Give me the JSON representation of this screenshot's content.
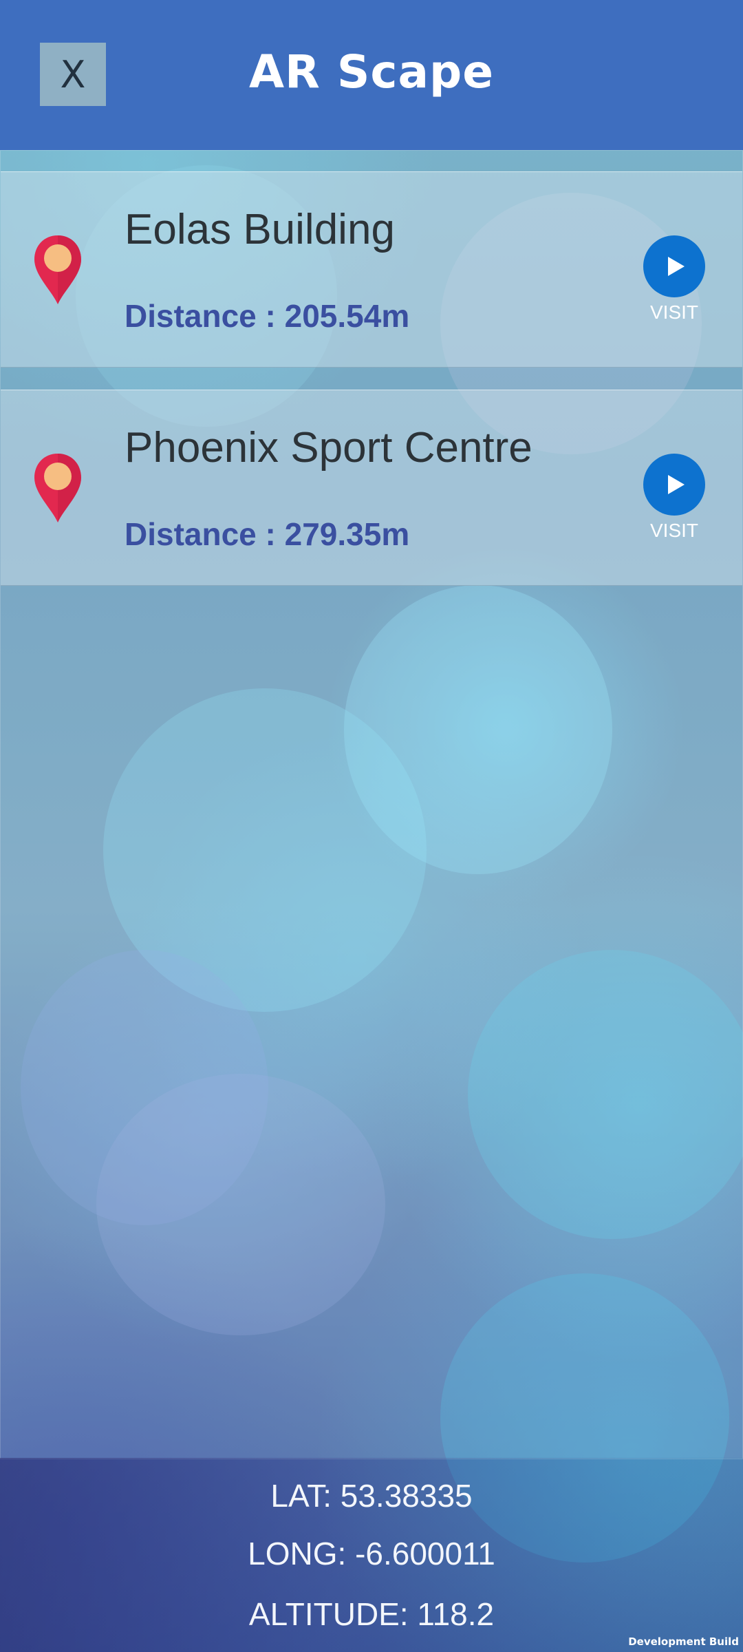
{
  "header": {
    "title": "AR Scape",
    "close_label": "X"
  },
  "locations": [
    {
      "name": "Eolas Building",
      "distance": "Distance : 205.54m",
      "visit_label": "VISIT"
    },
    {
      "name": "Phoenix Sport Centre",
      "distance": "Distance : 279.35m",
      "visit_label": "VISIT"
    }
  ],
  "footer": {
    "lat": "LAT: 53.38335",
    "long": "LONG: -6.600011",
    "altitude": "ALTITUDE: 118.2"
  },
  "build_tag": "Development Build",
  "colors": {
    "header": "#3e6ebf",
    "visit_button": "#0d72cf",
    "pin": "#e2284f",
    "distance_text": "#3a4fa0"
  },
  "icons": {
    "location": "map-pin-icon",
    "visit": "play-icon"
  }
}
